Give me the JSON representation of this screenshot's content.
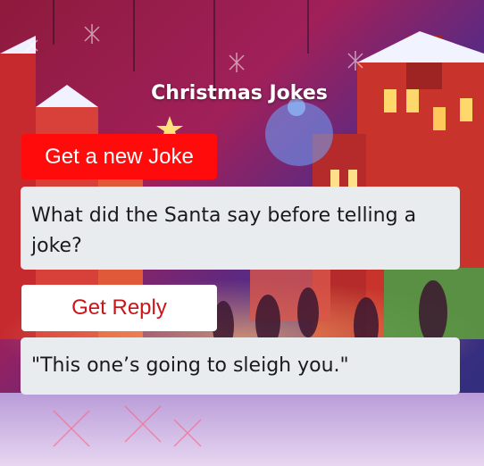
{
  "page": {
    "title": "Christmas Jokes"
  },
  "controls": {
    "new_joke_label": "Get a new Joke",
    "reply_label": "Get Reply"
  },
  "joke": {
    "question": "What did the Santa say before telling a joke?",
    "answer": "\"This one’s going to sleigh you.\""
  },
  "colors": {
    "new_joke_button": "#ff0b0b",
    "reply_text": "#c8161b",
    "card_background": "#e9ecef"
  },
  "icons": {
    "background": "christmas-market-illustration"
  }
}
